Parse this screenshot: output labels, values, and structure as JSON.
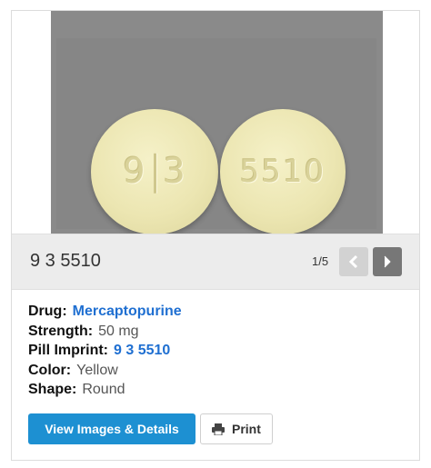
{
  "photo": {
    "left_pill_imprint_a": "9",
    "left_pill_imprint_b": "3",
    "right_pill_imprint": "5510",
    "pill_color": "#ece6b2",
    "background_color": "#8a8a8a"
  },
  "bar": {
    "imprint_title": "9 3 5510",
    "counter": "1/5",
    "prev_icon": "chevron-left-icon",
    "next_icon": "chevron-right-icon"
  },
  "details": {
    "drug_label": "Drug:",
    "drug_value": "Mercaptopurine",
    "strength_label": "Strength:",
    "strength_value": "50 mg",
    "imprint_label": "Pill Imprint:",
    "imprint_value": "9 3 5510",
    "color_label": "Color:",
    "color_value": "Yellow",
    "shape_label": "Shape:",
    "shape_value": "Round"
  },
  "actions": {
    "view_label": "View Images & Details",
    "print_label": "Print",
    "print_icon": "printer-icon",
    "accent_color": "#1d90d2",
    "link_color": "#1f6fd1"
  }
}
